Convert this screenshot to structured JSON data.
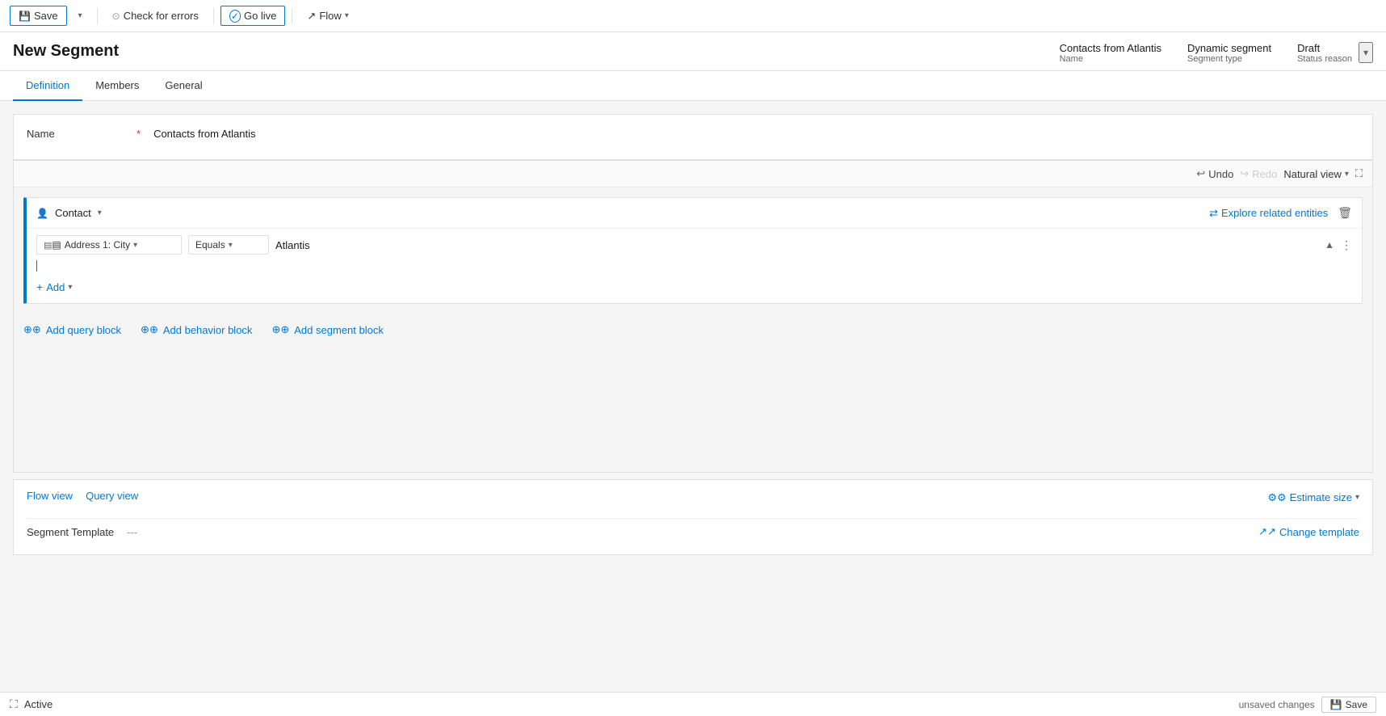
{
  "toolbar": {
    "save_label": "Save",
    "check_errors_label": "Check for errors",
    "go_live_label": "Go live",
    "flow_label": "Flow"
  },
  "page": {
    "title": "New Segment"
  },
  "header_meta": {
    "name_value": "Contacts from Atlantis",
    "name_label": "Name",
    "segment_type_value": "Dynamic segment",
    "segment_type_label": "Segment type",
    "status_value": "Draft",
    "status_label": "Status reason"
  },
  "tabs": [
    {
      "id": "definition",
      "label": "Definition",
      "active": true
    },
    {
      "id": "members",
      "label": "Members",
      "active": false
    },
    {
      "id": "general",
      "label": "General",
      "active": false
    }
  ],
  "form": {
    "name_label": "Name",
    "name_value": "Contacts from Atlantis"
  },
  "canvas": {
    "undo_label": "Undo",
    "redo_label": "Redo",
    "view_label": "Natural view",
    "query_block": {
      "title": "Contact",
      "explore_label": "Explore related entities",
      "condition": {
        "field": "Address 1: City",
        "operator": "Equals",
        "value": "Atlantis"
      },
      "add_label": "Add"
    },
    "add_query_block_label": "Add query block",
    "add_behavior_block_label": "Add behavior block",
    "add_segment_block_label": "Add segment block"
  },
  "bottom": {
    "flow_view_label": "Flow view",
    "query_view_label": "Query view",
    "estimate_size_label": "Estimate size",
    "segment_template_label": "Segment Template",
    "segment_template_value": "---",
    "change_template_label": "Change template"
  },
  "status_bar": {
    "active_label": "Active",
    "unsaved_label": "unsaved changes",
    "save_label": "Save"
  }
}
